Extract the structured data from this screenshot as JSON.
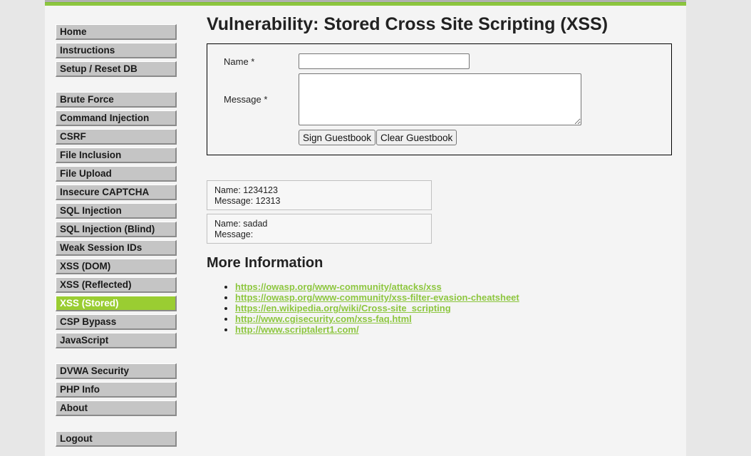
{
  "sidebar": {
    "groups": [
      [
        "Home",
        "Instructions",
        "Setup / Reset DB"
      ],
      [
        "Brute Force",
        "Command Injection",
        "CSRF",
        "File Inclusion",
        "File Upload",
        "Insecure CAPTCHA",
        "SQL Injection",
        "SQL Injection (Blind)",
        "Weak Session IDs",
        "XSS (DOM)",
        "XSS (Reflected)",
        "XSS (Stored)",
        "CSP Bypass",
        "JavaScript"
      ],
      [
        "DVWA Security",
        "PHP Info",
        "About"
      ],
      [
        "Logout"
      ]
    ],
    "selected": "XSS (Stored)"
  },
  "main": {
    "title": "Vulnerability: Stored Cross Site Scripting (XSS)",
    "form": {
      "name_label": "Name *",
      "name_value": "",
      "message_label": "Message *",
      "message_value": "",
      "sign_button": "Sign Guestbook",
      "clear_button": "Clear Guestbook"
    },
    "entries": [
      {
        "name_line": "Name: 1234123",
        "message_line": "Message: 12313"
      },
      {
        "name_line": "Name: sadad",
        "message_line": "Message:"
      }
    ],
    "more_info": {
      "title": "More Information",
      "links": [
        "https://owasp.org/www-community/attacks/xss",
        "https://owasp.org/www-community/xss-filter-evasion-cheatsheet",
        "https://en.wikipedia.org/wiki/Cross-site_scripting",
        "http://www.cgisecurity.com/xss-faq.html",
        "http://www.scriptalert1.com/"
      ]
    }
  },
  "colors": {
    "accent": "#8dc63f",
    "selected_menu": "#9acd32",
    "menu_bg": "#c5c5c5"
  }
}
